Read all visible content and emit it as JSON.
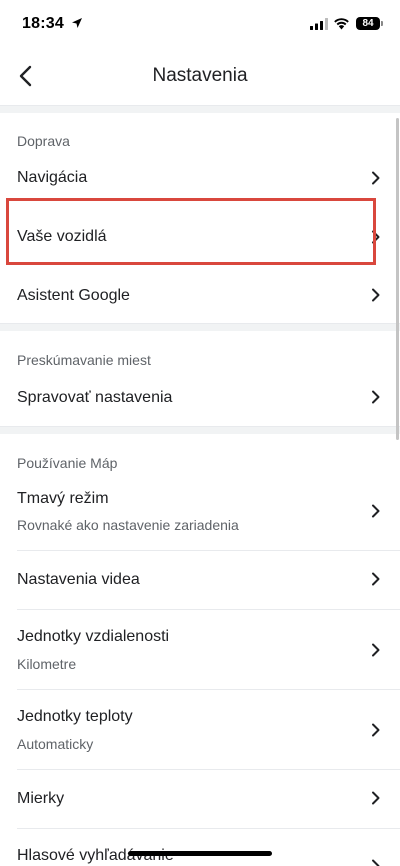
{
  "status_bar": {
    "time": "18:34",
    "battery": "84"
  },
  "header": {
    "title": "Nastavenia"
  },
  "sections": {
    "doprava": {
      "title": "Doprava",
      "items": [
        {
          "label": "Navigácia"
        },
        {
          "label": "Vaše vozidlá"
        },
        {
          "label": "Asistent Google"
        }
      ]
    },
    "preskumavanie": {
      "title": "Preskúmavanie miest",
      "items": [
        {
          "label": "Spravovať nastavenia"
        }
      ]
    },
    "pouzivanie": {
      "title": "Používanie Máp",
      "items": [
        {
          "label": "Tmavý režim",
          "sub": "Rovnaké ako nastavenie zariadenia"
        },
        {
          "label": "Nastavenia videa"
        },
        {
          "label": "Jednotky vzdialenosti",
          "sub": "Kilometre"
        },
        {
          "label": "Jednotky teploty",
          "sub": "Automaticky"
        },
        {
          "label": "Mierky"
        },
        {
          "label": "Hlasové vyhľadávanie"
        }
      ]
    }
  },
  "colors": {
    "highlight": "#d9473d",
    "text": "#202124",
    "secondary": "#5f6368"
  }
}
